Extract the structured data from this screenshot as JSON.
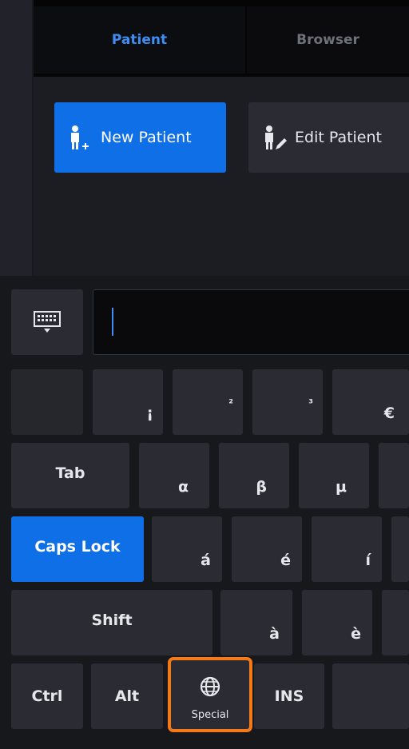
{
  "tabs": [
    {
      "label": "Patient",
      "active": true
    },
    {
      "label": "Browser",
      "active": false
    }
  ],
  "actions": {
    "new_patient": "New Patient",
    "edit_patient": "Edit Patient"
  },
  "text_field": {
    "value": ""
  },
  "keyboard": {
    "row1": [
      "",
      "¡",
      "²",
      "³",
      "€"
    ],
    "row2": [
      "Tab",
      "α",
      "β",
      "μ"
    ],
    "row3": [
      "Caps Lock",
      "á",
      "é",
      "í"
    ],
    "row4": [
      "Shift",
      "à",
      "è"
    ],
    "row5": [
      "Ctrl",
      "Alt",
      "Special",
      "INS"
    ]
  },
  "colors": {
    "accent": "#0f6fe6",
    "highlight": "#f47a18",
    "tab_active_text": "#3d8ef5"
  }
}
